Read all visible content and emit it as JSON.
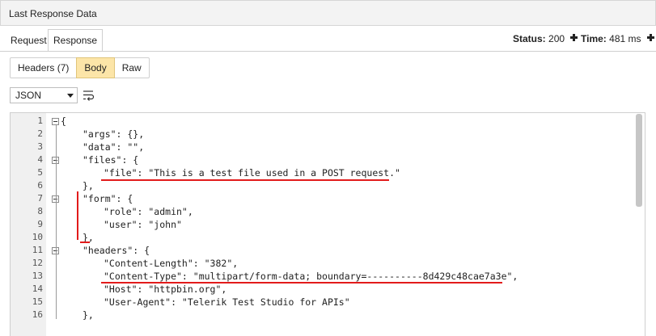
{
  "window": {
    "title": "Last Response Data"
  },
  "tabs": {
    "request": "Request",
    "response": "Response"
  },
  "status": {
    "status_label": "Status:",
    "status_value": "200",
    "time_label": "Time:",
    "time_value": "481 ms"
  },
  "view_tabs": {
    "headers": "Headers (7)",
    "body": "Body",
    "raw": "Raw"
  },
  "format_select": {
    "value": "JSON"
  },
  "editor": {
    "lines": [
      {
        "n": "1",
        "indent": 0,
        "text": "{"
      },
      {
        "n": "2",
        "indent": 1,
        "text": "\"args\": {},"
      },
      {
        "n": "3",
        "indent": 1,
        "text": "\"data\": \"\","
      },
      {
        "n": "4",
        "indent": 1,
        "text": "\"files\": {"
      },
      {
        "n": "5",
        "indent": 2,
        "text": "\"file\": \"This is a test file used in a POST request.\""
      },
      {
        "n": "6",
        "indent": 1,
        "text": "},"
      },
      {
        "n": "7",
        "indent": 1,
        "text": "\"form\": {"
      },
      {
        "n": "8",
        "indent": 2,
        "text": "\"role\": \"admin\","
      },
      {
        "n": "9",
        "indent": 2,
        "text": "\"user\": \"john\""
      },
      {
        "n": "10",
        "indent": 1,
        "text": "},"
      },
      {
        "n": "11",
        "indent": 1,
        "text": "\"headers\": {"
      },
      {
        "n": "12",
        "indent": 2,
        "text": "\"Content-Length\": \"382\","
      },
      {
        "n": "13",
        "indent": 2,
        "text": "\"Content-Type\": \"multipart/form-data; boundary=----------8d429c48cae7a3e\","
      },
      {
        "n": "14",
        "indent": 2,
        "text": "\"Host\": \"httpbin.org\","
      },
      {
        "n": "15",
        "indent": 2,
        "text": "\"User-Agent\": \"Telerik Test Studio for APIs\""
      },
      {
        "n": "16",
        "indent": 1,
        "text": "},"
      }
    ]
  },
  "colors": {
    "highlight_red": "#e21b1b",
    "active_tab_yellow": "#fce5a8"
  }
}
